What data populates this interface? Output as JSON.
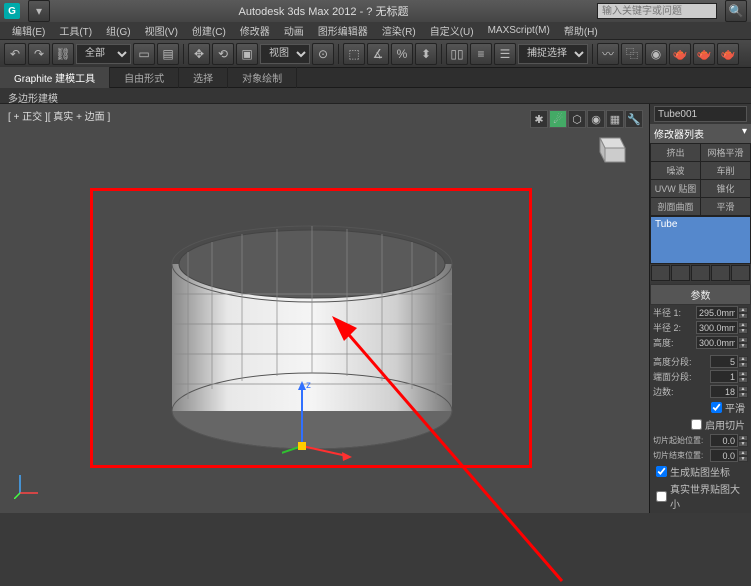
{
  "titlebar": {
    "title": "Autodesk 3ds Max 2012 - ?  无标题",
    "search_placeholder": "输入关键字或问题"
  },
  "menu": [
    "编辑(E)",
    "工具(T)",
    "组(G)",
    "视图(V)",
    "创建(C)",
    "修改器",
    "动画",
    "图形编辑器",
    "渲染(R)",
    "自定义(U)",
    "MAXScript(M)",
    "帮助(H)"
  ],
  "toolbar": {
    "all_dropdown": "全部",
    "view_dropdown": "视图",
    "snap_dropdown": "捕捉选择"
  },
  "tabs": {
    "items": [
      "Graphite 建模工具",
      "自由形式",
      "选择",
      "对象绘制"
    ],
    "sub": "多边形建模"
  },
  "viewport": {
    "label": "[ + 正交 ][ 真实 + 边面 ]"
  },
  "panel": {
    "object_name": "Tube001",
    "modifier_header": "修改器列表",
    "mod_buttons": [
      [
        "挤出",
        "网格平滑"
      ],
      [
        "噪波",
        "车削"
      ],
      [
        "UVW 贴图",
        "锥化"
      ],
      [
        "剖面曲面",
        "平滑"
      ]
    ],
    "stack_item": "Tube",
    "params_header": "参数",
    "params": {
      "radius1": {
        "label": "半径 1:",
        "value": "295.0mm"
      },
      "radius2": {
        "label": "半径 2:",
        "value": "300.0mm"
      },
      "height": {
        "label": "高度:",
        "value": "300.0mm"
      },
      "height_segs": {
        "label": "高度分段:",
        "value": "5"
      },
      "cap_segs": {
        "label": "端面分段:",
        "value": "1"
      },
      "sides": {
        "label": "边数:",
        "value": "18"
      }
    },
    "smooth": {
      "label": "平滑"
    },
    "slice": {
      "enable_label": "启用切片",
      "from_label": "切片起始位置:",
      "from_value": "0.0",
      "to_label": "切片结束位置:",
      "to_value": "0.0"
    },
    "mapping": {
      "gen_label": "生成贴图坐标",
      "real_label": "真实世界贴图大小"
    }
  }
}
